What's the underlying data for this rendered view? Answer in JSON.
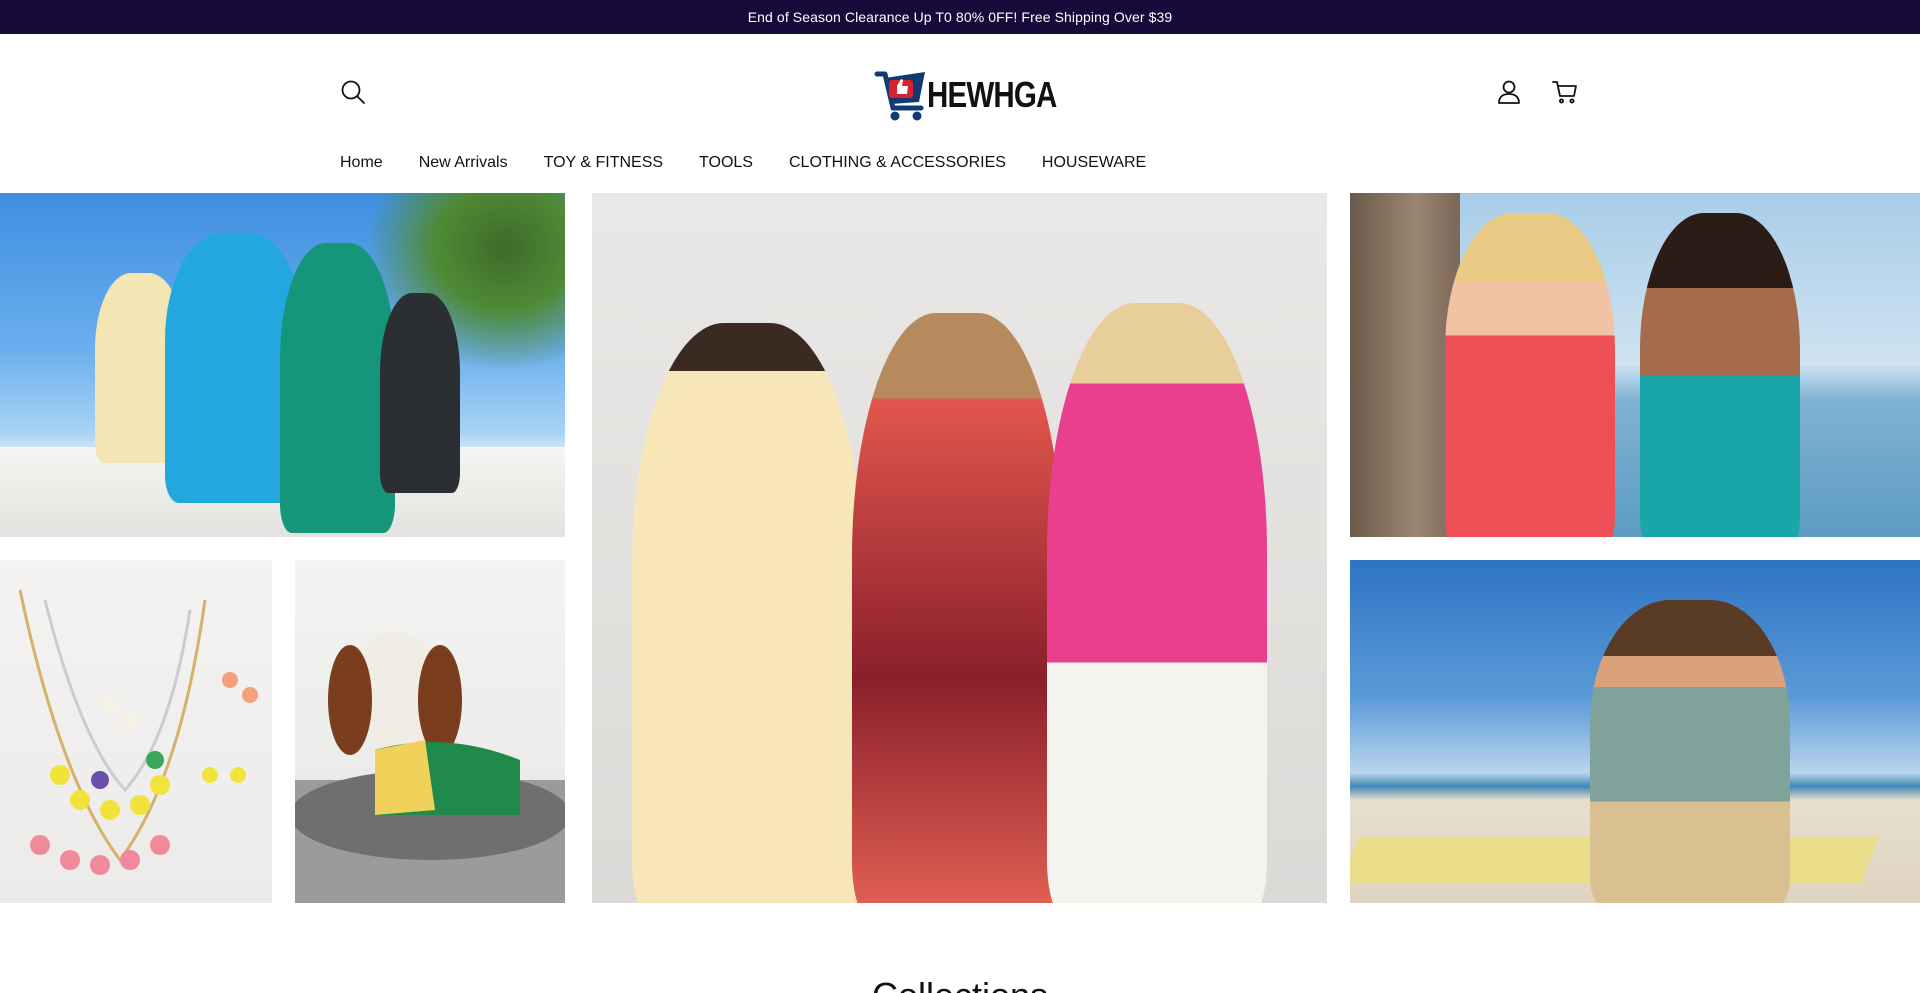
{
  "announcement": {
    "text": "End of Season Clearance Up T0 80% 0FF! Free Shipping Over $39"
  },
  "header": {
    "logo_text": "HEWHGA",
    "icons": {
      "search": "search-icon",
      "account": "user-icon",
      "cart": "cart-icon"
    }
  },
  "nav": {
    "items": [
      {
        "label": "Home"
      },
      {
        "label": "New Arrivals"
      },
      {
        "label": "TOY & FITNESS"
      },
      {
        "label": "TOOLS"
      },
      {
        "label": "CLOTHING & ACCESSORIES"
      },
      {
        "label": "HOUSEWARE"
      }
    ]
  },
  "hero": {
    "tiles": [
      {
        "subject": "family-photo"
      },
      {
        "subject": "women-fashion-photo"
      },
      {
        "subject": "swimwear-photo"
      },
      {
        "subject": "jewelry-photo"
      },
      {
        "subject": "dog-photo"
      },
      {
        "subject": "beach-menswear-photo"
      }
    ]
  },
  "collections": {
    "title": "Collections"
  },
  "colors": {
    "announcement_bg": "#150a3a",
    "brand_red": "#d8232a",
    "brand_navy": "#123a72"
  }
}
